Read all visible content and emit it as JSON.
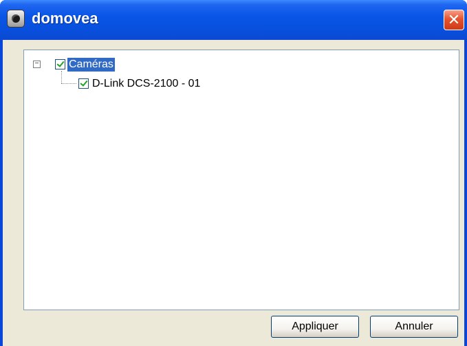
{
  "window": {
    "title": "domovea",
    "close_label": "✕"
  },
  "tree": {
    "root": {
      "expander": "−",
      "label": "Caméras",
      "checked": true,
      "selected": true
    },
    "children": [
      {
        "label": "D-Link DCS-2100 - 01",
        "checked": true
      }
    ]
  },
  "buttons": {
    "apply_label": "Appliquer",
    "cancel_label": "Annuler"
  },
  "colors": {
    "titlebar": "#0a55e6",
    "selection": "#316ac5",
    "face": "#ece9d8",
    "check": "#21a121"
  }
}
